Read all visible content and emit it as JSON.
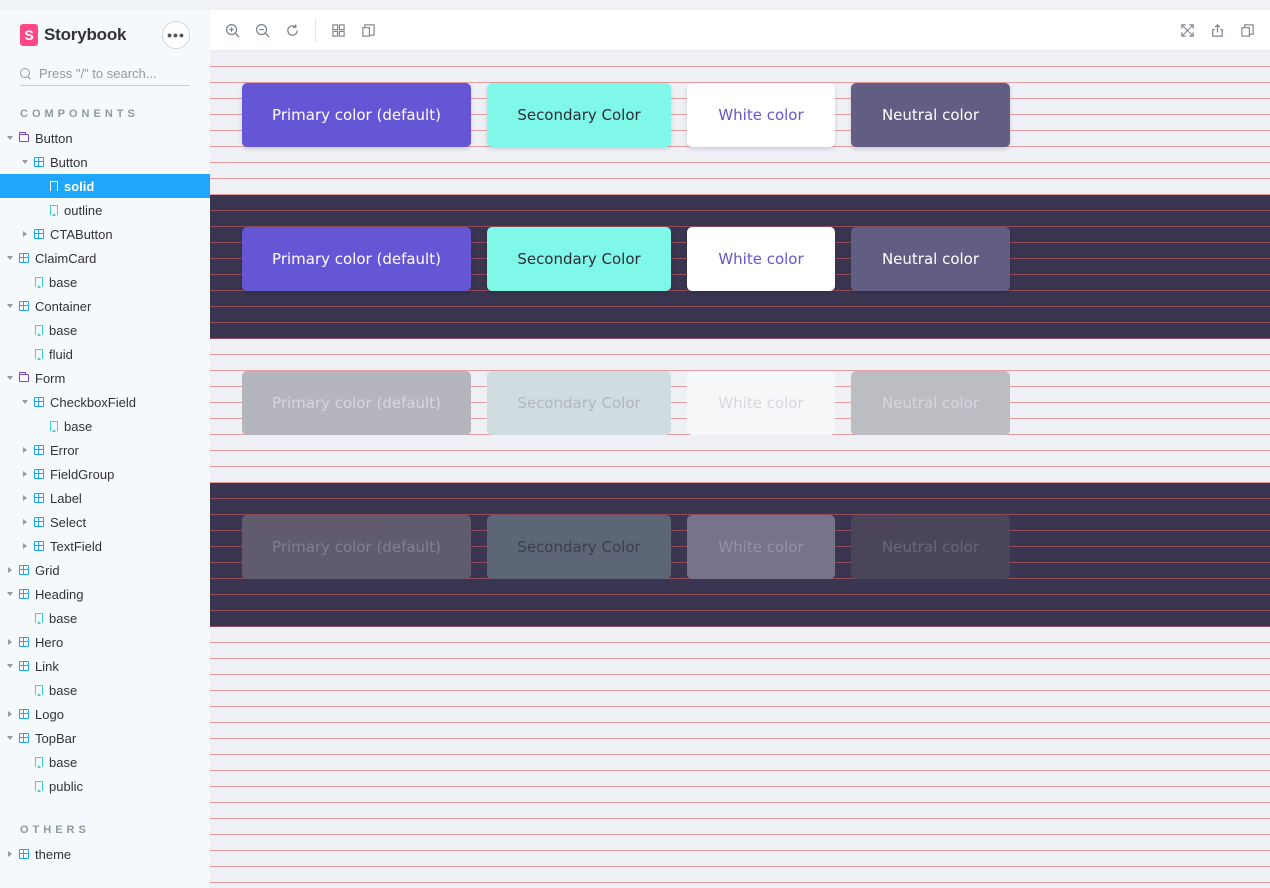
{
  "brand": {
    "logo_letter": "S",
    "name": "Storybook"
  },
  "menu": {
    "label": "•••"
  },
  "search": {
    "placeholder": "Press \"/\" to search..."
  },
  "sections": {
    "components": "COMPONENTS",
    "others": "OTHERS"
  },
  "tree": [
    {
      "label": "Button",
      "level": 0,
      "arrow": "down",
      "icon": "folder"
    },
    {
      "label": "Button",
      "level": 1,
      "arrow": "down",
      "icon": "component"
    },
    {
      "label": "solid",
      "level": 2,
      "arrow": "none",
      "icon": "story",
      "selected": true
    },
    {
      "label": "outline",
      "level": 2,
      "arrow": "none",
      "icon": "story"
    },
    {
      "label": "CTAButton",
      "level": 1,
      "arrow": "right",
      "icon": "component"
    },
    {
      "label": "ClaimCard",
      "level": 0,
      "arrow": "down",
      "icon": "component"
    },
    {
      "label": "base",
      "level": 1,
      "arrow": "none",
      "icon": "story"
    },
    {
      "label": "Container",
      "level": 0,
      "arrow": "down",
      "icon": "component"
    },
    {
      "label": "base",
      "level": 1,
      "arrow": "none",
      "icon": "story"
    },
    {
      "label": "fluid",
      "level": 1,
      "arrow": "none",
      "icon": "story"
    },
    {
      "label": "Form",
      "level": 0,
      "arrow": "down",
      "icon": "folder"
    },
    {
      "label": "CheckboxField",
      "level": 1,
      "arrow": "down",
      "icon": "component"
    },
    {
      "label": "base",
      "level": 2,
      "arrow": "none",
      "icon": "story"
    },
    {
      "label": "Error",
      "level": 1,
      "arrow": "right",
      "icon": "component"
    },
    {
      "label": "FieldGroup",
      "level": 1,
      "arrow": "right",
      "icon": "component"
    },
    {
      "label": "Label",
      "level": 1,
      "arrow": "right",
      "icon": "component"
    },
    {
      "label": "Select",
      "level": 1,
      "arrow": "right",
      "icon": "component"
    },
    {
      "label": "TextField",
      "level": 1,
      "arrow": "right",
      "icon": "component"
    },
    {
      "label": "Grid",
      "level": 0,
      "arrow": "right",
      "icon": "component"
    },
    {
      "label": "Heading",
      "level": 0,
      "arrow": "down",
      "icon": "component"
    },
    {
      "label": "base",
      "level": 1,
      "arrow": "none",
      "icon": "story"
    },
    {
      "label": "Hero",
      "level": 0,
      "arrow": "right",
      "icon": "component"
    },
    {
      "label": "Link",
      "level": 0,
      "arrow": "down",
      "icon": "component"
    },
    {
      "label": "base",
      "level": 1,
      "arrow": "none",
      "icon": "story"
    },
    {
      "label": "Logo",
      "level": 0,
      "arrow": "right",
      "icon": "component"
    },
    {
      "label": "TopBar",
      "level": 0,
      "arrow": "down",
      "icon": "component"
    },
    {
      "label": "base",
      "level": 1,
      "arrow": "none",
      "icon": "story"
    },
    {
      "label": "public",
      "level": 1,
      "arrow": "none",
      "icon": "story"
    }
  ],
  "others_tree": [
    {
      "label": "theme",
      "level": 0,
      "arrow": "right",
      "icon": "component"
    }
  ],
  "toolbar": {
    "icons": [
      "zoom-in-icon",
      "zoom-out-icon",
      "reset-zoom-icon",
      "grid-icon",
      "outline-icon",
      "fullscreen-icon",
      "share-icon",
      "copy-link-icon"
    ]
  },
  "canvas": {
    "buttons": {
      "primary": "Primary color (default)",
      "secondary": "Secondary Color",
      "white": "White color",
      "neutral": "Neutral color"
    }
  },
  "colors": {
    "accent": "#1ea7fd",
    "primary": "#6556d6",
    "secondary": "#7ff7e9",
    "neutral": "#625d82",
    "dark_band": "#3a3550",
    "brand": "#ff4785"
  }
}
